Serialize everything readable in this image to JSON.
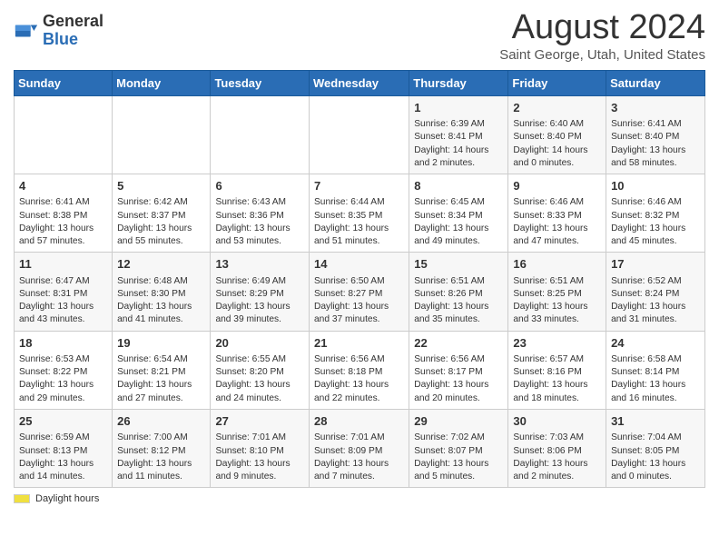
{
  "header": {
    "logo_general": "General",
    "logo_blue": "Blue",
    "month_title": "August 2024",
    "subtitle": "Saint George, Utah, United States"
  },
  "days_of_week": [
    "Sunday",
    "Monday",
    "Tuesday",
    "Wednesday",
    "Thursday",
    "Friday",
    "Saturday"
  ],
  "weeks": [
    [
      {
        "day": "",
        "info": ""
      },
      {
        "day": "",
        "info": ""
      },
      {
        "day": "",
        "info": ""
      },
      {
        "day": "",
        "info": ""
      },
      {
        "day": "1",
        "info": "Sunrise: 6:39 AM\nSunset: 8:41 PM\nDaylight: 14 hours\nand 2 minutes."
      },
      {
        "day": "2",
        "info": "Sunrise: 6:40 AM\nSunset: 8:40 PM\nDaylight: 14 hours\nand 0 minutes."
      },
      {
        "day": "3",
        "info": "Sunrise: 6:41 AM\nSunset: 8:40 PM\nDaylight: 13 hours\nand 58 minutes."
      }
    ],
    [
      {
        "day": "4",
        "info": "Sunrise: 6:41 AM\nSunset: 8:38 PM\nDaylight: 13 hours\nand 57 minutes."
      },
      {
        "day": "5",
        "info": "Sunrise: 6:42 AM\nSunset: 8:37 PM\nDaylight: 13 hours\nand 55 minutes."
      },
      {
        "day": "6",
        "info": "Sunrise: 6:43 AM\nSunset: 8:36 PM\nDaylight: 13 hours\nand 53 minutes."
      },
      {
        "day": "7",
        "info": "Sunrise: 6:44 AM\nSunset: 8:35 PM\nDaylight: 13 hours\nand 51 minutes."
      },
      {
        "day": "8",
        "info": "Sunrise: 6:45 AM\nSunset: 8:34 PM\nDaylight: 13 hours\nand 49 minutes."
      },
      {
        "day": "9",
        "info": "Sunrise: 6:46 AM\nSunset: 8:33 PM\nDaylight: 13 hours\nand 47 minutes."
      },
      {
        "day": "10",
        "info": "Sunrise: 6:46 AM\nSunset: 8:32 PM\nDaylight: 13 hours\nand 45 minutes."
      }
    ],
    [
      {
        "day": "11",
        "info": "Sunrise: 6:47 AM\nSunset: 8:31 PM\nDaylight: 13 hours\nand 43 minutes."
      },
      {
        "day": "12",
        "info": "Sunrise: 6:48 AM\nSunset: 8:30 PM\nDaylight: 13 hours\nand 41 minutes."
      },
      {
        "day": "13",
        "info": "Sunrise: 6:49 AM\nSunset: 8:29 PM\nDaylight: 13 hours\nand 39 minutes."
      },
      {
        "day": "14",
        "info": "Sunrise: 6:50 AM\nSunset: 8:27 PM\nDaylight: 13 hours\nand 37 minutes."
      },
      {
        "day": "15",
        "info": "Sunrise: 6:51 AM\nSunset: 8:26 PM\nDaylight: 13 hours\nand 35 minutes."
      },
      {
        "day": "16",
        "info": "Sunrise: 6:51 AM\nSunset: 8:25 PM\nDaylight: 13 hours\nand 33 minutes."
      },
      {
        "day": "17",
        "info": "Sunrise: 6:52 AM\nSunset: 8:24 PM\nDaylight: 13 hours\nand 31 minutes."
      }
    ],
    [
      {
        "day": "18",
        "info": "Sunrise: 6:53 AM\nSunset: 8:22 PM\nDaylight: 13 hours\nand 29 minutes."
      },
      {
        "day": "19",
        "info": "Sunrise: 6:54 AM\nSunset: 8:21 PM\nDaylight: 13 hours\nand 27 minutes."
      },
      {
        "day": "20",
        "info": "Sunrise: 6:55 AM\nSunset: 8:20 PM\nDaylight: 13 hours\nand 24 minutes."
      },
      {
        "day": "21",
        "info": "Sunrise: 6:56 AM\nSunset: 8:18 PM\nDaylight: 13 hours\nand 22 minutes."
      },
      {
        "day": "22",
        "info": "Sunrise: 6:56 AM\nSunset: 8:17 PM\nDaylight: 13 hours\nand 20 minutes."
      },
      {
        "day": "23",
        "info": "Sunrise: 6:57 AM\nSunset: 8:16 PM\nDaylight: 13 hours\nand 18 minutes."
      },
      {
        "day": "24",
        "info": "Sunrise: 6:58 AM\nSunset: 8:14 PM\nDaylight: 13 hours\nand 16 minutes."
      }
    ],
    [
      {
        "day": "25",
        "info": "Sunrise: 6:59 AM\nSunset: 8:13 PM\nDaylight: 13 hours\nand 14 minutes."
      },
      {
        "day": "26",
        "info": "Sunrise: 7:00 AM\nSunset: 8:12 PM\nDaylight: 13 hours\nand 11 minutes."
      },
      {
        "day": "27",
        "info": "Sunrise: 7:01 AM\nSunset: 8:10 PM\nDaylight: 13 hours\nand 9 minutes."
      },
      {
        "day": "28",
        "info": "Sunrise: 7:01 AM\nSunset: 8:09 PM\nDaylight: 13 hours\nand 7 minutes."
      },
      {
        "day": "29",
        "info": "Sunrise: 7:02 AM\nSunset: 8:07 PM\nDaylight: 13 hours\nand 5 minutes."
      },
      {
        "day": "30",
        "info": "Sunrise: 7:03 AM\nSunset: 8:06 PM\nDaylight: 13 hours\nand 2 minutes."
      },
      {
        "day": "31",
        "info": "Sunrise: 7:04 AM\nSunset: 8:05 PM\nDaylight: 13 hours\nand 0 minutes."
      }
    ]
  ],
  "footer": {
    "daylight_label": "Daylight hours"
  }
}
